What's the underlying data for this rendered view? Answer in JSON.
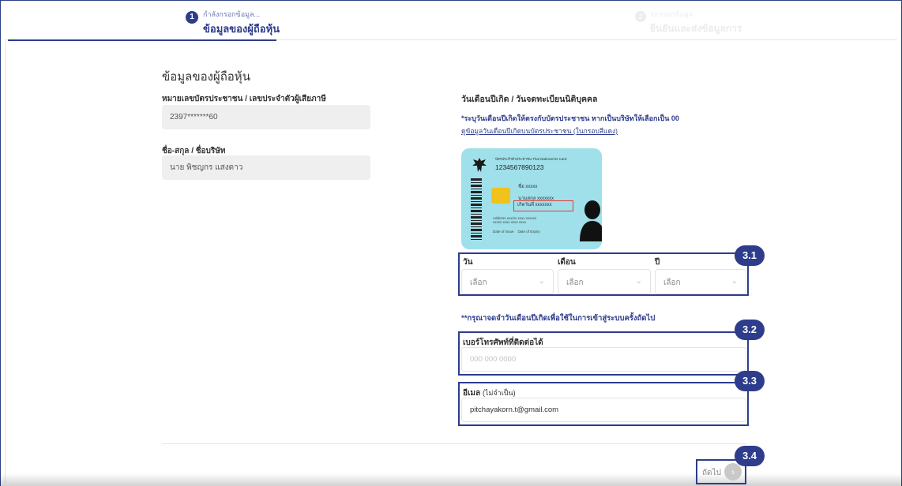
{
  "stepper": {
    "step1": {
      "number": "1",
      "subtitle": "กำลังกรอกข้อมูล...",
      "title": "ข้อมูลของผู้ถือหุ้น"
    },
    "step2": {
      "number": "2",
      "subtitle": "รอกรอกข้อมูล",
      "title": "ยืนยันและส่งข้อมูลการ"
    }
  },
  "section": {
    "title": "ข้อมูลของผู้ถือหุ้น"
  },
  "left": {
    "id_label": "หมายเลขบัตรประชาชน / เลขประจำตัวผู้เสียภาษี",
    "id_value": "2397*******60",
    "name_label": "ชื่อ-สกุล / ชื่อบริษัท",
    "name_value": "นาย พิชญกร แสงดาว"
  },
  "right": {
    "birth_title": "วันเดือนปีเกิด / วันจดทะเบียนนิติบุคคล",
    "birth_note": "*ระบุวันเดือนปีเกิดให้ตรงกับบัตรประชาชน หากเป็นบริษัทให้เลือกเป็น 00",
    "birth_link": "ดูข้อมูลวันเดือนปีเกิดบนบัตรประชาชน (ในกรอบสีแดง)"
  },
  "idcard": {
    "header": "บัตรประจำตัวประชาชน Thai National ID Card",
    "number": "1234567890123",
    "name_line": "ชื่อ      xxxxx",
    "surname_line": "นามสกุล  xxxxxxx",
    "birth_line": "เกิดวันที่  xxxxxxx",
    "address_line1": "Address xxx/xx xxxx xxxxxx",
    "address_line2": "xxxxx xxxx xxxx xxxx",
    "issue_label": "Date of Issue",
    "expiry_label": "Date of Expiry"
  },
  "date_select": {
    "day_label": "วัน",
    "month_label": "เดือน",
    "year_label": "ปี",
    "day_value": "เลือก",
    "month_value": "เลือก",
    "year_value": "เลือก"
  },
  "remember_note": "**กรุณาจดจำวันเดือนปีเกิดเพื่อใช้ในการเข้าสู่ระบบครั้งถัดไป",
  "phone": {
    "label": "เบอร์โทรศัพท์ที่ติดต่อได้",
    "placeholder": "000 000 0000",
    "value": ""
  },
  "email": {
    "label": "อีเมล",
    "optional": "(ไม่จำเป็น)",
    "value": "pitchayakorn.t@gmail.com"
  },
  "next": {
    "label": "ถัดไป",
    "icon": "arrow-right-icon"
  },
  "annotations": [
    "3.1",
    "3.2",
    "3.3",
    "3.4"
  ],
  "colors": {
    "primary": "#2e3c8c",
    "card": "#9fe0ea",
    "highlight_red": "#e03b3b",
    "chip": "#f0c21c"
  }
}
